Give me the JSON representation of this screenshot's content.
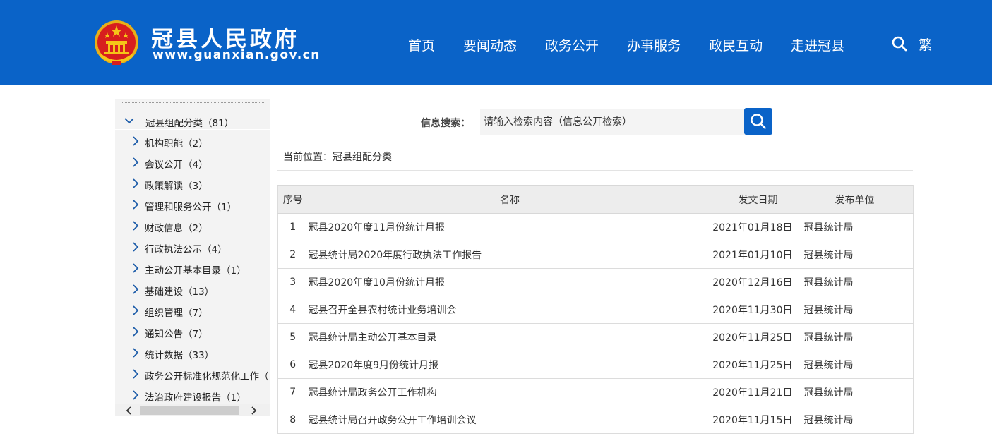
{
  "header": {
    "site_name": "冠县人民政府",
    "site_url": "www.guanxian.gov.cn",
    "nav": [
      "首页",
      "要闻动态",
      "政务公开",
      "办事服务",
      "政民互动",
      "走进冠县"
    ],
    "search_icon": "search-icon",
    "trad_label": "繁",
    "brand_color": "#0a63c8"
  },
  "sidebar": {
    "root": "冠县组配分类（81）",
    "items": [
      "机构职能（2）",
      "会议公开（4）",
      "政策解读（3）",
      "管理和服务公开（1）",
      "财政信息（2）",
      "行政执法公示（4）",
      "主动公开基本目录（1）",
      "基础建设（13）",
      "组织管理（7）",
      "通知公告（7）",
      "统计数据（33）",
      "政务公开标准化规范化工作（",
      "法治政府建设报告（1）"
    ]
  },
  "search": {
    "label": "信息搜索：",
    "placeholder": "请输入检索内容（信息公开检索）"
  },
  "breadcrumb": "当前位置：冠县组配分类",
  "table": {
    "headers": {
      "num": "序号",
      "name": "名称",
      "date": "发文日期",
      "unit": "发布单位"
    },
    "rows": [
      {
        "num": "1",
        "name": "冠县2020年度11月份统计月报",
        "date": "2021年01月18日",
        "unit": "冠县统计局"
      },
      {
        "num": "2",
        "name": "冠县统计局2020年度行政执法工作报告",
        "date": "2021年01月10日",
        "unit": "冠县统计局"
      },
      {
        "num": "3",
        "name": "冠县2020年度10月份统计月报",
        "date": "2020年12月16日",
        "unit": "冠县统计局"
      },
      {
        "num": "4",
        "name": "冠县召开全县农村统计业务培训会",
        "date": "2020年11月30日",
        "unit": "冠县统计局"
      },
      {
        "num": "5",
        "name": "冠县统计局主动公开基本目录",
        "date": "2020年11月25日",
        "unit": "冠县统计局"
      },
      {
        "num": "6",
        "name": "冠县2020年度9月份统计月报",
        "date": "2020年11月25日",
        "unit": "冠县统计局"
      },
      {
        "num": "7",
        "name": "冠县统计局政务公开工作机构",
        "date": "2020年11月21日",
        "unit": "冠县统计局"
      },
      {
        "num": "8",
        "name": "冠县统计局召开政务公开工作培训会议",
        "date": "2020年11月15日",
        "unit": "冠县统计局"
      }
    ]
  }
}
